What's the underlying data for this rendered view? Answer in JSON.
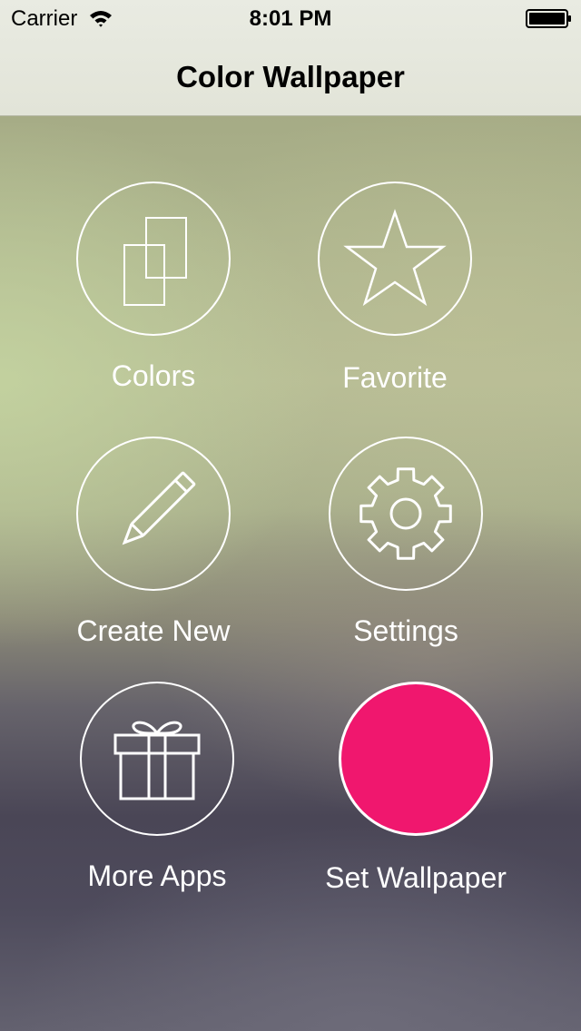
{
  "status_bar": {
    "carrier": "Carrier",
    "time": "8:01 PM",
    "icons": [
      "wifi-icon",
      "battery-icon"
    ]
  },
  "nav": {
    "title": "Color Wallpaper"
  },
  "menu": {
    "colors": {
      "label": "Colors",
      "icon": "layers-icon"
    },
    "favorite": {
      "label": "Favorite",
      "icon": "star-icon"
    },
    "create_new": {
      "label": "Create New",
      "icon": "pencil-icon"
    },
    "settings": {
      "label": "Settings",
      "icon": "gear-icon"
    },
    "more_apps": {
      "label": "More Apps",
      "icon": "gift-icon"
    },
    "set_wallpaper": {
      "label": "Set Wallpaper",
      "swatch_color": "#f0176e"
    }
  },
  "colors": {
    "nav_background": "#e6e8de",
    "accent_swatch": "#f0176e",
    "icon_stroke": "#ffffff"
  }
}
